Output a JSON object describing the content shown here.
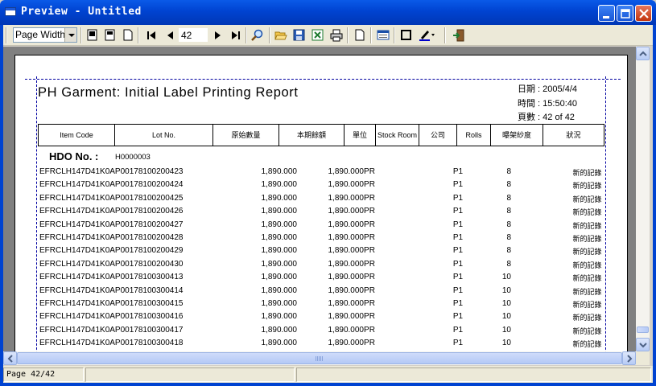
{
  "window": {
    "title": "Preview - Untitled"
  },
  "toolbar": {
    "zoom_value": "Page Width",
    "page_number": "42",
    "icons": [
      "single-page-icon",
      "two-page-icon",
      "multi-page-icon",
      "first-page-icon",
      "prev-page-icon",
      "next-page-icon",
      "last-page-icon",
      "zoom-icon",
      "open-icon",
      "save-icon",
      "excel-export-icon",
      "print-icon",
      "page-setup-icon",
      "properties-icon",
      "border-icon",
      "color-icon",
      "exit-icon"
    ]
  },
  "report": {
    "title": "PH Garment: Initial Label Printing Report",
    "date_line": "日期 : 2005/4/4",
    "time_line": "時間 : 15:50:40",
    "page_line": "頁數 : 42 of 42",
    "columns": [
      "Item Code",
      "Lot No.",
      "原始數量",
      "本期餘額",
      "單位",
      "Stock Room",
      "公司",
      "Rolls",
      "曝架紗度",
      "狀況"
    ],
    "hdo_label": "HDO No. :",
    "hdo_value": "H0000003",
    "rows": [
      {
        "code": "EFRCLH147D41K0AP00178100200423",
        "q1": "1,890.000",
        "q2": "1,890.000",
        "unit": "PR",
        "co": "P1",
        "rolls": "8",
        "status": "新的記錄"
      },
      {
        "code": "EFRCLH147D41K0AP00178100200424",
        "q1": "1,890.000",
        "q2": "1,890.000",
        "unit": "PR",
        "co": "P1",
        "rolls": "8",
        "status": "新的記錄"
      },
      {
        "code": "EFRCLH147D41K0AP00178100200425",
        "q1": "1,890.000",
        "q2": "1,890.000",
        "unit": "PR",
        "co": "P1",
        "rolls": "8",
        "status": "新的記錄"
      },
      {
        "code": "EFRCLH147D41K0AP00178100200426",
        "q1": "1,890.000",
        "q2": "1,890.000",
        "unit": "PR",
        "co": "P1",
        "rolls": "8",
        "status": "新的記錄"
      },
      {
        "code": "EFRCLH147D41K0AP00178100200427",
        "q1": "1,890.000",
        "q2": "1,890.000",
        "unit": "PR",
        "co": "P1",
        "rolls": "8",
        "status": "新的記錄"
      },
      {
        "code": "EFRCLH147D41K0AP00178100200428",
        "q1": "1,890.000",
        "q2": "1,890.000",
        "unit": "PR",
        "co": "P1",
        "rolls": "8",
        "status": "新的記錄"
      },
      {
        "code": "EFRCLH147D41K0AP00178100200429",
        "q1": "1,890.000",
        "q2": "1,890.000",
        "unit": "PR",
        "co": "P1",
        "rolls": "8",
        "status": "新的記錄"
      },
      {
        "code": "EFRCLH147D41K0AP00178100200430",
        "q1": "1,890.000",
        "q2": "1,890.000",
        "unit": "PR",
        "co": "P1",
        "rolls": "8",
        "status": "新的記錄"
      },
      {
        "code": "EFRCLH147D41K0AP00178100300413",
        "q1": "1,890.000",
        "q2": "1,890.000",
        "unit": "PR",
        "co": "P1",
        "rolls": "10",
        "status": "新的記錄"
      },
      {
        "code": "EFRCLH147D41K0AP00178100300414",
        "q1": "1,890.000",
        "q2": "1,890.000",
        "unit": "PR",
        "co": "P1",
        "rolls": "10",
        "status": "新的記錄"
      },
      {
        "code": "EFRCLH147D41K0AP00178100300415",
        "q1": "1,890.000",
        "q2": "1,890.000",
        "unit": "PR",
        "co": "P1",
        "rolls": "10",
        "status": "新的記錄"
      },
      {
        "code": "EFRCLH147D41K0AP00178100300416",
        "q1": "1,890.000",
        "q2": "1,890.000",
        "unit": "PR",
        "co": "P1",
        "rolls": "10",
        "status": "新的記錄"
      },
      {
        "code": "EFRCLH147D41K0AP00178100300417",
        "q1": "1,890.000",
        "q2": "1,890.000",
        "unit": "PR",
        "co": "P1",
        "rolls": "10",
        "status": "新的記錄"
      },
      {
        "code": "EFRCLH147D41K0AP00178100300418",
        "q1": "1,890.000",
        "q2": "1,890.000",
        "unit": "PR",
        "co": "P1",
        "rolls": "10",
        "status": "新的記錄"
      }
    ]
  },
  "statusbar": {
    "page_text": "Page 42/42"
  },
  "colors": {
    "titlebar": "#0043d1",
    "viewport_bg": "#808080",
    "margin_line": "#0000a0",
    "chrome": "#ece9d8"
  }
}
